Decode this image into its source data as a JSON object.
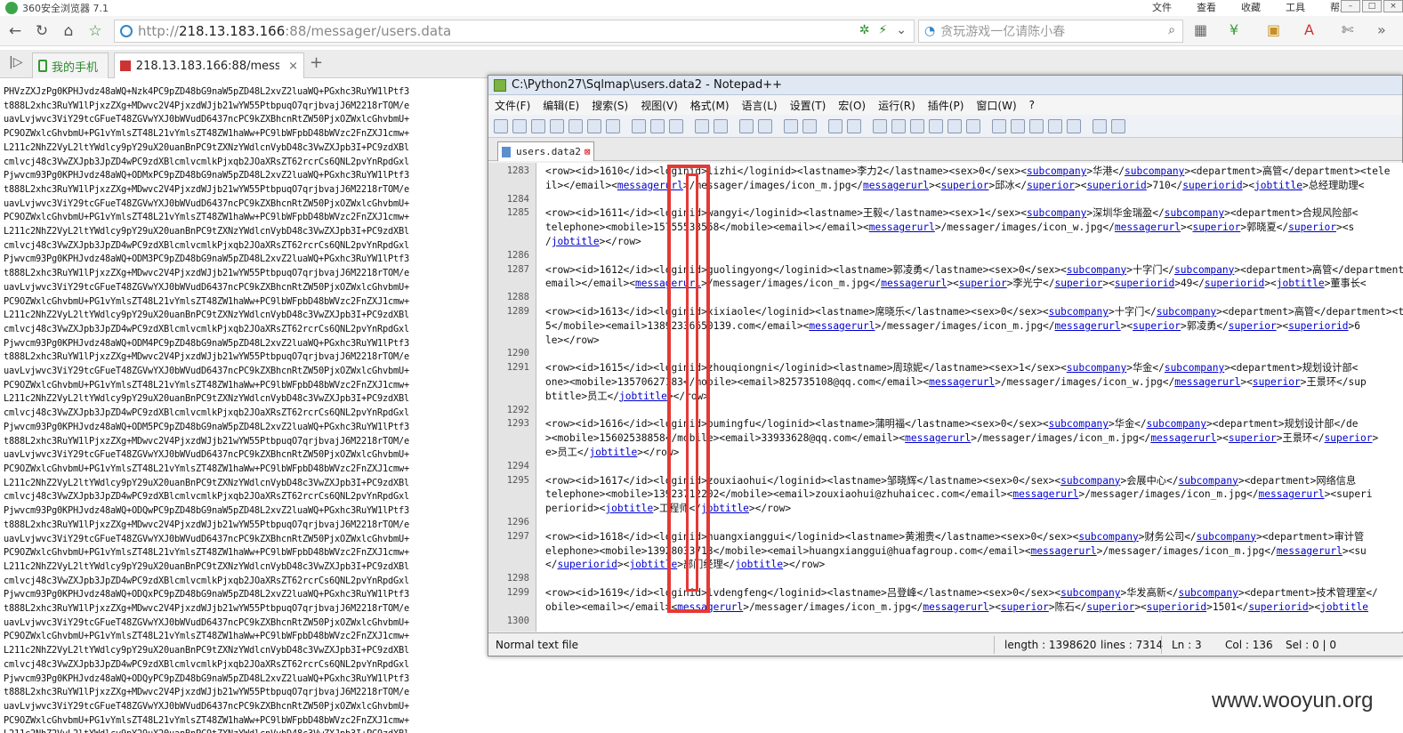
{
  "browser": {
    "title": "360安全浏览器 7.1",
    "menus": [
      "文件",
      "查看",
      "收藏",
      "工具",
      "帮助"
    ],
    "url_scheme": "http://",
    "url_host": "218.13.183.166",
    "url_path": ":88/messager/users.data",
    "search_placeholder": "贪玩游戏一亿请陈小春",
    "tabs": [
      {
        "label": "我的手机"
      },
      {
        "label": "218.13.183.166:88/messager"
      }
    ]
  },
  "page_text": "PHVzZXJzPg0KPHJvdz48aWQ+Nzk4PC9pZD48bG9naW5pZD48L2xvZ2luaWQ+PGxhc3RuYW1lPtf3\nt888L2xhc3RuYW1lPjxzZXg+MDwvc2V4PjxzdWJjb21wYW55PtbpuqO7qrjbvajJ6M2218rTOM/e\nuavLvjwvc3ViY29tcGFueT48ZGVwYXJ0bWVudD6437ncPC9kZXBhcnRtZW50PjxOZWxlcGhvbmU+\nPC9OZWxlcGhvbmU+PG1vYmlsZT48L21vYmlsZT48ZW1haWw+PC9lbWFpbD48bWVzc2FnZXJ1cmw+\nL211c2NhZ2VyL2ltYWdlcy9pY29uX20uanBnPC9tZXNzYWdlcnVybD48c3VwZXJpb3I+PC9zdXBl\ncmlvcj48c3VwZXJpb3JpZD4wPC9zdXBlcmlvcmlkPjxqb2JOaXRsZT62rcrCs6QNL2pvYnRpdGxl\nPjwvcm93Pg0KPHJvdz48aWQ+ODMxPC9pZD48bG9naW5pZD48L2xvZ2luaWQ+PGxhc3RuYW1lPtf3\nt888L2xhc3RuYW1lPjxzZXg+MDwvc2V4PjxzdWJjb21wYW55PtbpuqO7qrjbvajJ6M2218rTOM/e\nuavLvjwvc3ViY29tcGFueT48ZGVwYXJ0bWVudD6437ncPC9kZXBhcnRtZW50PjxOZWxlcGhvbmU+\nPC9OZWxlcGhvbmU+PG1vYmlsZT48L21vYmlsZT48ZW1haWw+PC9lbWFpbD48bWVzc2FnZXJ1cmw+\nL211c2NhZ2VyL2ltYWdlcy9pY29uX20uanBnPC9tZXNzYWdlcnVybD48c3VwZXJpb3I+PC9zdXBl\ncmlvcj48c3VwZXJpb3JpZD4wPC9zdXBlcmlvcmlkPjxqb2JOaXRsZT62rcrCs6QNL2pvYnRpdGxl\nPjwvcm93Pg0KPHJvdz48aWQ+ODM3PC9pZD48bG9naW5pZD48L2xvZ2luaWQ+PGxhc3RuYW1lPtf3\nt888L2xhc3RuYW1lPjxzZXg+MDwvc2V4PjxzdWJjb21wYW55PtbpuqO7qrjbvajJ6M2218rTOM/e\nuavLvjwvc3ViY29tcGFueT48ZGVwYXJ0bWVudD6437ncPC9kZXBhcnRtZW50PjxOZWxlcGhvbmU+\nPC9OZWxlcGhvbmU+PG1vYmlsZT48L21vYmlsZT48ZW1haWw+PC9lbWFpbD48bWVzc2FnZXJ1cmw+\nL211c2NhZ2VyL2ltYWdlcy9pY29uX20uanBnPC9tZXNzYWdlcnVybD48c3VwZXJpb3I+PC9zdXBl\ncmlvcj48c3VwZXJpb3JpZD4wPC9zdXBlcmlvcmlkPjxqb2JOaXRsZT62rcrCs6QNL2pvYnRpdGxl\nPjwvcm93Pg0KPHJvdz48aWQ+ODM4PC9pZD48bG9naW5pZD48L2xvZ2luaWQ+PGxhc3RuYW1lPtf3\nt888L2xhc3RuYW1lPjxzZXg+MDwvc2V4PjxzdWJjb21wYW55PtbpuqO7qrjbvajJ6M2218rTOM/e\nuavLvjwvc3ViY29tcGFueT48ZGVwYXJ0bWVudD6437ncPC9kZXBhcnRtZW50PjxOZWxlcGhvbmU+\nPC9OZWxlcGhvbmU+PG1vYmlsZT48L21vYmlsZT48ZW1haWw+PC9lbWFpbD48bWVzc2FnZXJ1cmw+\nL211c2NhZ2VyL2ltYWdlcy9pY29uX20uanBnPC9tZXNzYWdlcnVybD48c3VwZXJpb3I+PC9zdXBl\ncmlvcj48c3VwZXJpb3JpZD4wPC9zdXBlcmlvcmlkPjxqb2JOaXRsZT62rcrCs6QNL2pvYnRpdGxl\nPjwvcm93Pg0KPHJvdz48aWQ+ODM5PC9pZD48bG9naW5pZD48L2xvZ2luaWQ+PGxhc3RuYW1lPtf3\nt888L2xhc3RuYW1lPjxzZXg+MDwvc2V4PjxzdWJjb21wYW55PtbpuqO7qrjbvajJ6M2218rTOM/e\nuavLvjwvc3ViY29tcGFueT48ZGVwYXJ0bWVudD6437ncPC9kZXBhcnRtZW50PjxOZWxlcGhvbmU+\nPC9OZWxlcGhvbmU+PG1vYmlsZT48L21vYmlsZT48ZW1haWw+PC9lbWFpbD48bWVzc2FnZXJ1cmw+\nL211c2NhZ2VyL2ltYWdlcy9pY29uX20uanBnPC9tZXNzYWdlcnVybD48c3VwZXJpb3I+PC9zdXBl\ncmlvcj48c3VwZXJpb3JpZD4wPC9zdXBlcmlvcmlkPjxqb2JOaXRsZT62rcrCs6QNL2pvYnRpdGxl\nPjwvcm93Pg0KPHJvdz48aWQ+ODQwPC9pZD48bG9naW5pZD48L2xvZ2luaWQ+PGxhc3RuYW1lPtf3\nt888L2xhc3RuYW1lPjxzZXg+MDwvc2V4PjxzdWJjb21wYW55PtbpuqO7qrjbvajJ6M2218rTOM/e\nuavLvjwvc3ViY29tcGFueT48ZGVwYXJ0bWVudD6437ncPC9kZXBhcnRtZW50PjxOZWxlcGhvbmU+\nPC9OZWxlcGhvbmU+PG1vYmlsZT48L21vYmlsZT48ZW1haWw+PC9lbWFpbD48bWVzc2FnZXJ1cmw+\nL211c2NhZ2VyL2ltYWdlcy9pY29uX20uanBnPC9tZXNzYWdlcnVybD48c3VwZXJpb3I+PC9zdXBl\ncmlvcj48c3VwZXJpb3JpZD4wPC9zdXBlcmlvcmlkPjxqb2JOaXRsZT62rcrCs6QNL2pvYnRpdGxl\nPjwvcm93Pg0KPHJvdz48aWQ+ODQxPC9pZD48bG9naW5pZD48L2xvZ2luaWQ+PGxhc3RuYW1lPtf3\nt888L2xhc3RuYW1lPjxzZXg+MDwvc2V4PjxzdWJjb21wYW55PtbpuqO7qrjbvajJ6M2218rTOM/e\nuavLvjwvc3ViY29tcGFueT48ZGVwYXJ0bWVudD6437ncPC9kZXBhcnRtZW50PjxOZWxlcGhvbmU+\nPC9OZWxlcGhvbmU+PG1vYmlsZT48L21vYmlsZT48ZW1haWw+PC9lbWFpbD48bWVzc2FnZXJ1cmw+\nL211c2NhZ2VyL2ltYWdlcy9pY29uX20uanBnPC9tZXNzYWdlcnVybD48c3VwZXJpb3I+PC9zdXBl\ncmlvcj48c3VwZXJpb3JpZD4wPC9zdXBlcmlvcmlkPjxqb2JOaXRsZT62rcrCs6QNL2pvYnRpdGxl\nPjwvcm93Pg0KPHJvdz48aWQ+ODQyPC9pZD48bG9naW5pZD48L2xvZ2luaWQ+PGxhc3RuYW1lPtf3\nt888L2xhc3RuYW1lPjxzZXg+MDwvc2V4PjxzdWJjb21wYW55PtbpuqO7qrjbvajJ6M2218rTOM/e\nuavLvjwvc3ViY29tcGFueT48ZGVwYXJ0bWVudD6437ncPC9kZXBhcnRtZW50PjxOZWxlcGhvbmU+\nPC9OZWxlcGhvbmU+PG1vYmlsZT48L21vYmlsZT48ZW1haWw+PC9lbWFpbD48bWVzc2FnZXJ1cmw+\nL211c2NhZ2VyL2ltYWdlcy9pY29uX20uanBnPC9tZXNzYWdlcnVybD48c3VwZXJpb3I+PC9zdXBl\ncmlvcj48c3VwZXJpb3JpZD4wPC9zdXBlcmlvcmlkPjxqb2JOaXRsZT62rcrCs6QNL2pvYnRpdGxl\nPjwvcm93Pg0KPHJvdz48aWQ+ODQzPC9pZD48bG9naW5pZD48L2xvZ2luaWQ+PGxhc3RuYW1lPtf3\nt888L2xhc3RuYW1lPjxzZXg+MDwvc2V4PjxzdWJjb21wYW55PtbpuqO7qrjbvajJ6M2218rTOM/e\nuavLvjwvc3ViY29tcGFueT48ZGVwYXJ0bWVudD6437ncPC9kZXBhcnRtZW50PjxOZWxlcGhvbmU+",
  "notepad": {
    "title": "C:\\Python27\\Sqlmap\\users.data2 - Notepad++",
    "menu": [
      "文件(F)",
      "编辑(E)",
      "搜索(S)",
      "视图(V)",
      "格式(M)",
      "语言(L)",
      "设置(T)",
      "宏(O)",
      "运行(R)",
      "插件(P)",
      "窗口(W)",
      "?"
    ],
    "tab_label": "users.data2",
    "lines": [
      {
        "n": "1283",
        "t": "<row><id>1610</id><loginid>lizhi</loginid><lastname>李力2</lastname><sex>0</sex><subcompany>华港</subcompany><department>高管</department><tele"
      },
      {
        "n": "",
        "t": "il></email><messagerurl>/messager/images/icon_m.jpg</messagerurl><superior>邱冰</superior><superiorid>710</superiorid><jobtitle>总经理助理<"
      },
      {
        "n": "1284",
        "t": ""
      },
      {
        "n": "1285",
        "t": "<row><id>1611</id><loginid>wangyi</loginid><lastname>王毅</lastname><sex>1</sex><subcompany>深圳华金瑞盈</subcompany><department>合规风险部<"
      },
      {
        "n": "",
        "t": "telephone><mobile>15755533558</mobile><email></email><messagerurl>/messager/images/icon_w.jpg</messagerurl><superior>郭晓夏</superior><s"
      },
      {
        "n": "",
        "t": "/jobtitle></row>"
      },
      {
        "n": "1286",
        "t": ""
      },
      {
        "n": "1287",
        "t": "<row><id>1612</id><loginid>guolingyong</loginid><lastname>郭凌勇</lastname><sex>0</sex><subcompany>十字门</subcompany><department>高管</department><te"
      },
      {
        "n": "",
        "t": "email></email><messagerurl>/messager/images/icon_m.jpg</messagerurl><superior>李光宁</superior><superiorid>49</superiorid><jobtitle>董事长<"
      },
      {
        "n": "1288",
        "t": ""
      },
      {
        "n": "1289",
        "t": "<row><id>1613</id><loginid>xixiaole</loginid><lastname>席晓乐</lastname><sex>0</sex><subcompany>十字门</subcompany><department>高管</department><te"
      },
      {
        "n": "",
        "t": "5</mobile><email>13892336650139.com</email><messagerurl>/messager/images/icon_m.jpg</messagerurl><superior>郭凌勇</superior><superiorid>6"
      },
      {
        "n": "",
        "t": "le></row>"
      },
      {
        "n": "1290",
        "t": ""
      },
      {
        "n": "1291",
        "t": "<row><id>1615</id><loginid>zhouqiongni</loginid><lastname>周琼妮</lastname><sex>1</sex><subcompany>华金</subcompany><department>规划设计部<"
      },
      {
        "n": "",
        "t": "one><mobile>13570627183</mobile><email>825735108@qq.com</email><messagerurl>/messager/images/icon_w.jpg</messagerurl><superior>王景环</sup"
      },
      {
        "n": "",
        "t": "btitle>员工</jobtitle></row>"
      },
      {
        "n": "1292",
        "t": ""
      },
      {
        "n": "1293",
        "t": "<row><id>1616</id><loginid>pumingfu</loginid><lastname>蒲明福</lastname><sex>0</sex><subcompany>华金</subcompany><department>规划设计部</de"
      },
      {
        "n": "",
        "t": "><mobile>15602538858</mobile><email>33933628@qq.com</email><messagerurl>/messager/images/icon_m.jpg</messagerurl><superior>王景环</superior>"
      },
      {
        "n": "",
        "t": "e>员工</jobtitle></row>"
      },
      {
        "n": "1294",
        "t": ""
      },
      {
        "n": "1295",
        "t": "<row><id>1617</id><loginid>zouxiaohui</loginid><lastname>邹晓辉</lastname><sex>0</sex><subcompany>会展中心</subcompany><department>网络信息"
      },
      {
        "n": "",
        "t": "telephone><mobile>13923712202</mobile><email>zouxiaohui@zhuhaicec.com</email><messagerurl>/messager/images/icon_m.jpg</messagerurl><superi"
      },
      {
        "n": "",
        "t": "periorid><jobtitle>工程师</jobtitle></row>"
      },
      {
        "n": "1296",
        "t": ""
      },
      {
        "n": "1297",
        "t": "<row><id>1618</id><loginid>huangxianggui</loginid><lastname>黄湘贵</lastname><sex>0</sex><subcompany>财务公司</subcompany><department>审计管"
      },
      {
        "n": "",
        "t": "elephone><mobile>13928033713</mobile><email>huangxianggui@huafagroup.com</email><messagerurl>/messager/images/icon_m.jpg</messagerurl><su"
      },
      {
        "n": "",
        "t": "</superiorid><jobtitle>部门经理</jobtitle></row>"
      },
      {
        "n": "1298",
        "t": ""
      },
      {
        "n": "1299",
        "t": "<row><id>1619</id><loginid>lvdengfeng</loginid><lastname>吕登峰</lastname><sex>0</sex><subcompany>华发高新</subcompany><department>技术管理室</"
      },
      {
        "n": "",
        "t": "obile><email></email><messagerurl>/messager/images/icon_m.jpg</messagerurl><superior>陈石</superior><superiorid>1501</superiorid><jobtitle"
      },
      {
        "n": "1300",
        "t": ""
      }
    ],
    "status": {
      "type": "Normal text file",
      "length": "length : 1398620",
      "lines": "lines : 7314",
      "ln": "Ln : 3",
      "col": "Col : 136",
      "sel": "Sel : 0 | 0"
    }
  },
  "watermark": "www.wooyun.org",
  "colors": {
    "highlight": "#e53935",
    "link": "#0000cc"
  }
}
